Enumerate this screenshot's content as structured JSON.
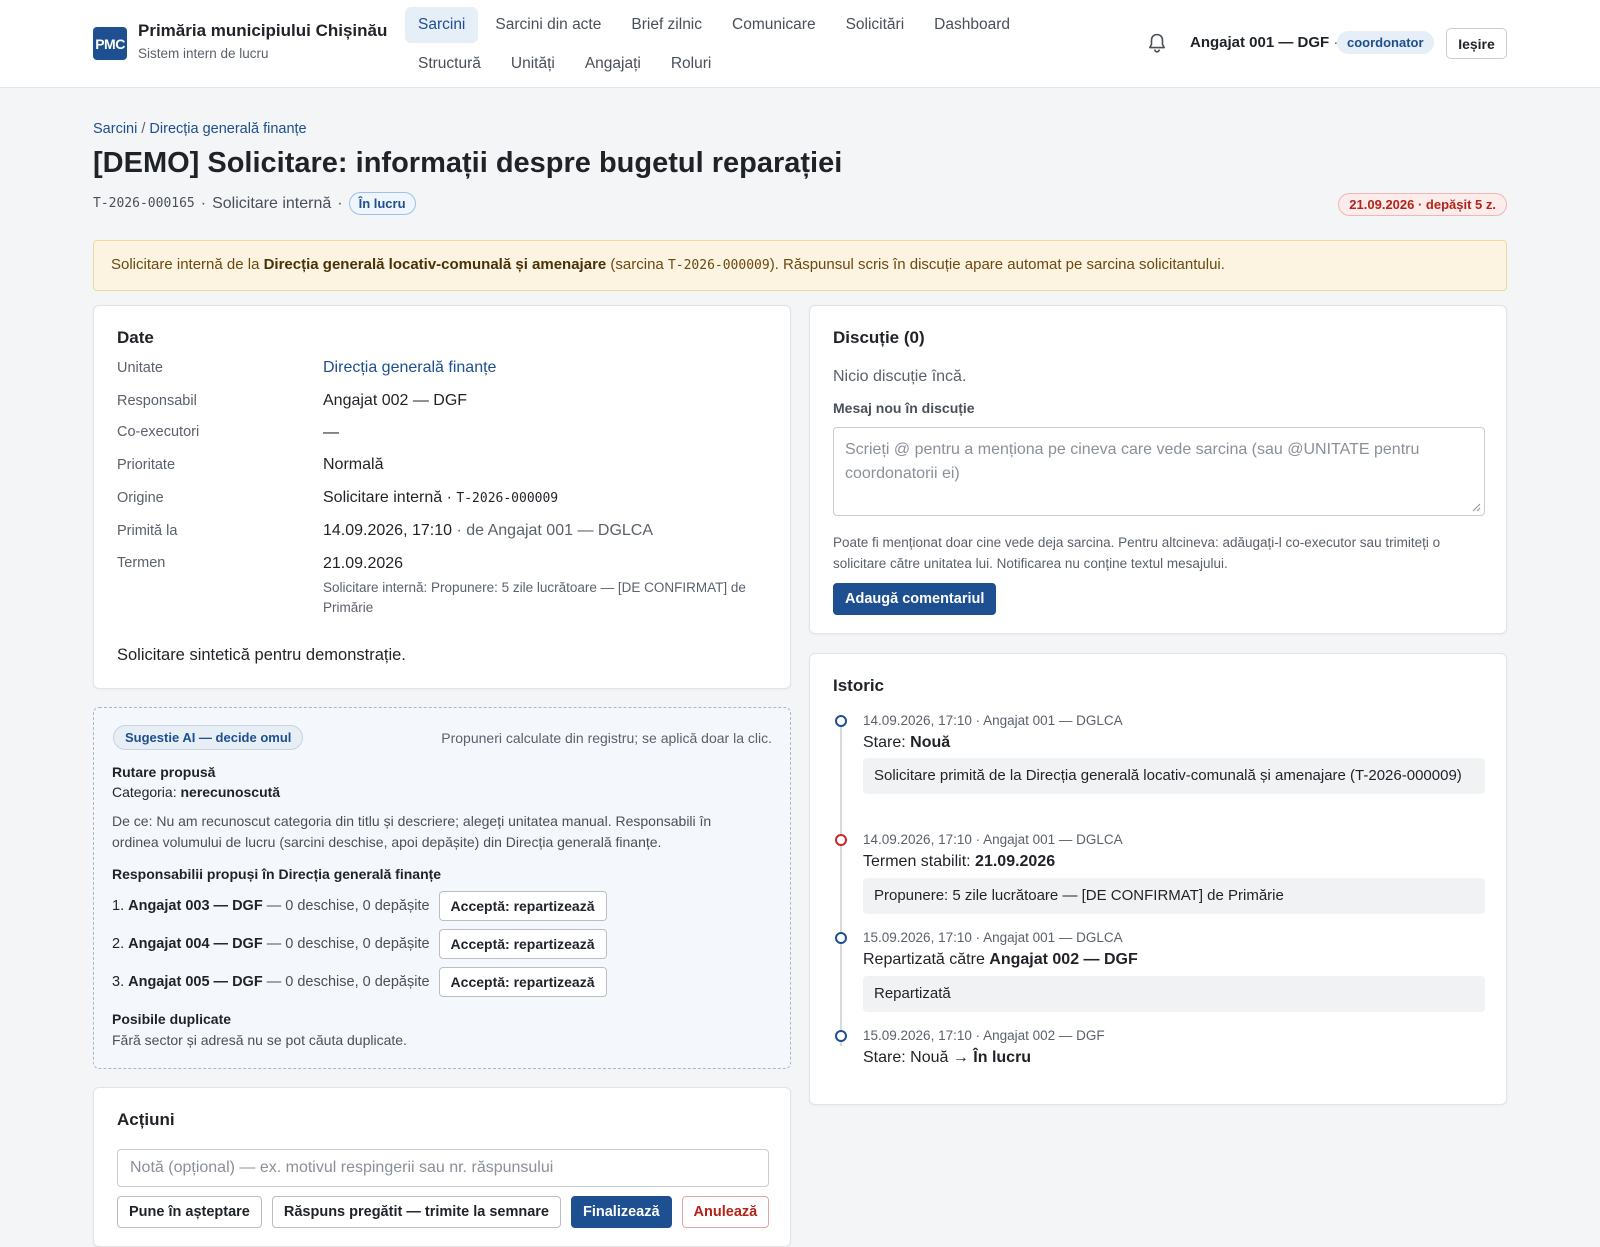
{
  "header": {
    "logo_text": "PMC",
    "org_name": "Primăria municipiului Chișinău",
    "org_sub": "Sistem intern de lucru",
    "nav_row1": [
      "Sarcini",
      "Sarcini din acte",
      "Brief zilnic",
      "Comunicare",
      "Solicitări",
      "Dashboard"
    ],
    "nav_row2": [
      "Structură",
      "Unități",
      "Angajați",
      "Roluri"
    ],
    "active_nav": "Sarcini",
    "user_name": "Angajat 001 — DGF",
    "user_sep": "·",
    "user_role": "coordonator",
    "logout_label": "Ieșire",
    "icons": {
      "notifications": "bell-icon"
    }
  },
  "breadcrumb": {
    "root": "Sarcini",
    "sep": "/",
    "current": "Direcția generală finanțe"
  },
  "task": {
    "title": "[DEMO] Solicitare: informații despre bugetul reparației",
    "id": "T-2026-000165",
    "dot": "·",
    "type": "Solicitare internă",
    "status": "În lucru",
    "deadline_badge": "21.09.2026 · depășit 5 z."
  },
  "notice": {
    "pre": "Solicitare internă de la ",
    "unit": "Direcția generală locativ-comunală și amenajare",
    "mid": " (sarcina ",
    "ref": "T-2026-000009",
    "post": "). Răspunsul scris în discuție apare automat pe sarcina solicitantului."
  },
  "details": {
    "heading": "Date",
    "unit_label": "Unitate",
    "unit_value": "Direcția generală finanțe",
    "resp_label": "Responsabil",
    "resp_value": "Angajat 002 — DGF",
    "coex_label": "Co-executori",
    "coex_value": "—",
    "prio_label": "Prioritate",
    "prio_value": "Normală",
    "origin_label": "Origine",
    "origin_value": "Solicitare internă · ",
    "origin_ref": "T-2026-000009",
    "recv_label": "Primită la",
    "recv_value": "14.09.2026, 17:10",
    "recv_by": " · de Angajat 001 — DGLCA",
    "term_label": "Termen",
    "term_value": "21.09.2026",
    "term_note": "Solicitare internă: Propunere: 5 zile lucrătoare — [DE CONFIRMAT] de Primărie",
    "description": "Solicitare sintetică pentru demonstrație."
  },
  "ai": {
    "badge": "Sugestie AI — decide omul",
    "hint": "Propuneri calculate din registru; se aplică doar la clic.",
    "routing_title": "Rutare propusă",
    "category_label": "Categoria: ",
    "category_value": "nerecunoscută",
    "why": "De ce: Nu am recunoscut categoria din titlu și descriere; alegeți unitatea manual. Responsabili în ordinea volumului de lucru (sarcini deschise, apoi depășite) din Direcția generală finanțe.",
    "resp_title": "Responsabilii propuși în Direcția generală finanțe",
    "candidates": [
      {
        "num": "1.",
        "name": "Angajat 003 — DGF",
        "stats": " — 0 deschise, 0 depășite",
        "action": "Acceptă: repartizează"
      },
      {
        "num": "2.",
        "name": "Angajat 004 — DGF",
        "stats": " — 0 deschise, 0 depășite",
        "action": "Acceptă: repartizează"
      },
      {
        "num": "3.",
        "name": "Angajat 005 — DGF",
        "stats": " — 0 deschise, 0 depășite",
        "action": "Acceptă: repartizează"
      }
    ],
    "dup_title": "Posibile duplicate",
    "dup_text": "Fără sector și adresă nu se pot căuta duplicate."
  },
  "actions": {
    "heading": "Acțiuni",
    "note_placeholder": "Notă (opțional) — ex. motivul respingerii sau nr. răspunsului",
    "buttons": [
      "Pune în așteptare",
      "Răspuns pregătit — trimite la semnare",
      "Finalizează",
      "Anulează"
    ]
  },
  "discussion": {
    "heading": "Discuție (0)",
    "empty": "Nicio discuție încă.",
    "label": "Mesaj nou în discuție",
    "placeholder": "Scrieți @ pentru a menționa pe cineva care vede sarcina (sau @UNITATE pentru coordonatorii ei)",
    "help": "Poate fi menționat doar cine vede deja sarcina. Pentru altcineva: adăugați-l co-executor sau trimiteți o solicitare către unitatea lui. Notificarea nu conține textul mesajului.",
    "submit": "Adaugă comentariul"
  },
  "history": {
    "heading": "Istoric",
    "events": [
      {
        "meta": "14.09.2026, 17:10 · Angajat 001 — DGLCA",
        "title_pre": "Stare: ",
        "title_bold": "Nouă",
        "box": "Solicitare primită de la Direcția generală locativ-comunală și amenajare (T-2026-000009)"
      },
      {
        "meta": "14.09.2026, 17:10 · Angajat 001 — DGLCA",
        "title_pre": "Termen stabilit: ",
        "title_bold": "21.09.2026",
        "box": "Propunere: 5 zile lucrătoare — [DE CONFIRMAT] de Primărie"
      },
      {
        "meta": "15.09.2026, 17:10 · Angajat 001 — DGLCA",
        "title_pre": "Repartizată către ",
        "title_bold": "Angajat 002 — DGF",
        "box": "Repartizată"
      },
      {
        "meta": "15.09.2026, 17:10 · Angajat 002 — DGF",
        "title_pre": "Stare: Nouă → ",
        "title_bold": "În lucru",
        "box": ""
      }
    ]
  },
  "colors": {
    "primary": "#1d4f91",
    "danger": "#b42318",
    "notice_bg": "#fdf3e1",
    "ai_bg": "#f4f8fc"
  }
}
